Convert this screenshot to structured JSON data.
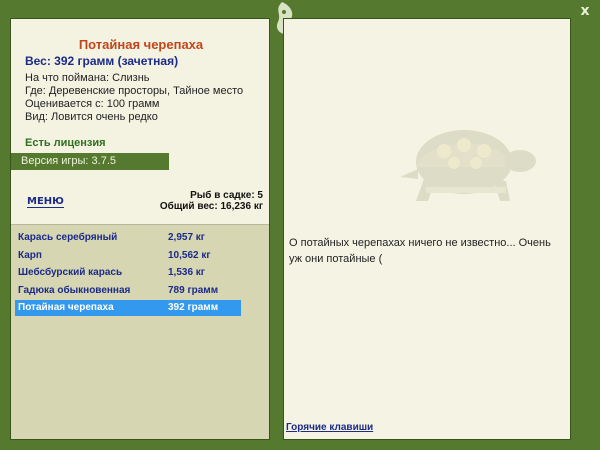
{
  "window": {
    "close_glyph": "x"
  },
  "details": {
    "title": "Потайная черепаха",
    "weight": "Вес: 392 грамм (зачетная)",
    "bait": "На что поймана: Слизнь",
    "location": "Где: Деревенские просторы, Тайное место",
    "value": "Оценивается с: 100 грамм",
    "kind": "Вид: Ловится очень редко"
  },
  "license": "Есть лицензия",
  "version": "Версия игры: 3.7.5",
  "menu_label": "МЕНЮ",
  "keepnet": {
    "count": "Рыб в садке: 5",
    "total": "Общий вес: 16,236 кг"
  },
  "catch": [
    {
      "name": "Карась серебряный",
      "weight": "2,957 кг",
      "selected": false
    },
    {
      "name": "Карп",
      "weight": "10,562 кг",
      "selected": false
    },
    {
      "name": "Шебсбурский карась",
      "weight": "1,536 кг",
      "selected": false
    },
    {
      "name": "Гадюка обыкновенная",
      "weight": "789 грамм",
      "selected": false
    },
    {
      "name": "Потайная черепаха",
      "weight": "392 грамм",
      "selected": true
    }
  ],
  "info_text": "О потайных черепахах ничего не известно... Очень уж они потайные (",
  "hotkeys": "Горячие клавиши",
  "colors": {
    "frame": "#55792f",
    "panel": "#f4f3e2",
    "accent_title": "#c0461c",
    "selection": "#3399ee"
  }
}
